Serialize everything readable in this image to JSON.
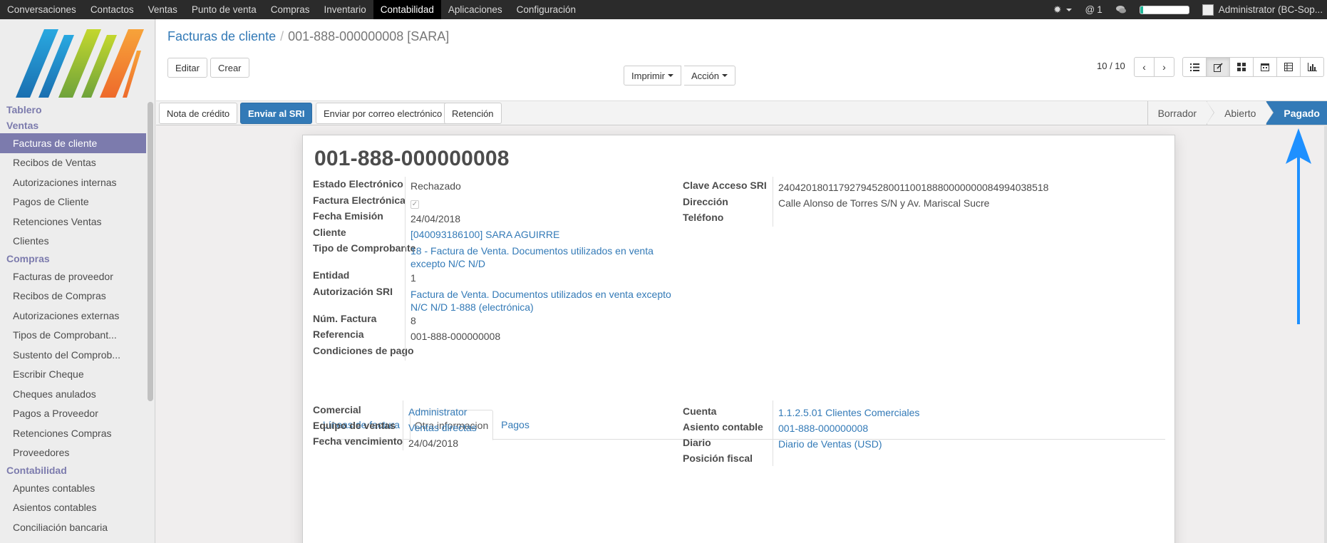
{
  "topbar": {
    "menu": [
      "Conversaciones",
      "Contactos",
      "Ventas",
      "Punto de venta",
      "Compras",
      "Inventario",
      "Contabilidad",
      "Aplicaciones",
      "Configuración"
    ],
    "active_menu": "Contabilidad",
    "mention_count": "1",
    "mention_symbol": "@",
    "user": "Administrator (BC-Sop...",
    "progress_fraction": 0.06,
    "progress_color": "#21b799"
  },
  "sidebar": {
    "sections": [
      {
        "head": "Tablero",
        "items": []
      },
      {
        "head": "Ventas",
        "items": [
          "Facturas de cliente",
          "Recibos de Ventas",
          "Autorizaciones internas",
          "Pagos de Cliente",
          "Retenciones Ventas",
          "Clientes"
        ]
      },
      {
        "head": "Compras",
        "items": [
          "Facturas de proveedor",
          "Recibos de Compras",
          "Autorizaciones externas",
          "Tipos de Comprobant...",
          "Sustento del Comprob...",
          "Escribir Cheque",
          "Cheques anulados",
          "Pagos a Proveedor",
          "Retenciones Compras",
          "Proveedores"
        ]
      },
      {
        "head": "Contabilidad",
        "items": [
          "Apuntes contables",
          "Asientos contables",
          "Conciliación bancaria"
        ]
      }
    ],
    "active_item": "Facturas de cliente",
    "accent_color": "#7c7bad"
  },
  "control_panel": {
    "breadcrumb_parent": "Facturas de cliente",
    "breadcrumb_sep": "/",
    "breadcrumb_current": "001-888-000000008 [SARA]",
    "edit_label": "Editar",
    "create_label": "Crear",
    "print_label": "Imprimir",
    "action_label": "Acción",
    "pager": "10 / 10"
  },
  "statusbar": {
    "buttons": [
      "Nota de crédito",
      "Enviar al SRI",
      "Enviar por correo electrónico",
      "Retención"
    ],
    "stages": [
      "Borrador",
      "Abierto",
      "Pagado"
    ],
    "current_stage": "Pagado",
    "primary_color": "#337ab7"
  },
  "form": {
    "title": "001-888-000000008",
    "left_fields": [
      {
        "label": "Estado Electrónico",
        "value": "Rechazado",
        "link": false
      },
      {
        "label": "Factura Electrónica",
        "value": "",
        "checkbox": true
      },
      {
        "label": "Fecha Emisión",
        "value": "24/04/2018",
        "link": false
      },
      {
        "label": "Cliente",
        "value": "[040093186100] SARA AGUIRRE",
        "link": true
      },
      {
        "label": "Tipo de Comprobante",
        "value": "18 - Factura de Venta. Documentos utilizados en venta excepto N/C N/D",
        "link": true
      },
      {
        "label": "Entidad",
        "value": "1",
        "link": false
      },
      {
        "label": "Autorización SRI",
        "value": "Factura de Venta. Documentos utilizados en venta excepto N/C N/D 1-888 (electrónica)",
        "link": true
      },
      {
        "label": "Núm. Factura",
        "value": "8",
        "link": false
      },
      {
        "label": "Referencia",
        "value": "001-888-000000008",
        "link": false
      },
      {
        "label": "Condiciones de pago",
        "value": "",
        "link": false
      }
    ],
    "right_fields": [
      {
        "label": "Clave Acceso SRI",
        "value": "2404201801179279452800110018880000000084994038518",
        "link": false
      },
      {
        "label": "Dirección",
        "value": "Calle Alonso de Torres S/N y Av. Mariscal Sucre",
        "link": false
      },
      {
        "label": "Teléfono",
        "value": "",
        "link": false
      }
    ],
    "tabs": [
      "Líneas de factura",
      "Otra informacion",
      "Pagos"
    ],
    "active_tab": "Otra informacion",
    "other_left": [
      {
        "label": "Comercial",
        "value": "Administrator",
        "link": true
      },
      {
        "label": "Equipo de ventas",
        "value": "Ventas directas",
        "link": true
      },
      {
        "label": "Fecha vencimiento",
        "value": "24/04/2018",
        "link": false
      }
    ],
    "other_right": [
      {
        "label": "Cuenta",
        "value": "1.1.2.5.01 Clientes Comerciales",
        "link": true
      },
      {
        "label": "Asiento contable",
        "value": "001-888-000000008",
        "link": true
      },
      {
        "label": "Diario",
        "value": "Diario de Ventas (USD)",
        "link": true
      },
      {
        "label": "Posición fiscal",
        "value": "",
        "link": false
      }
    ]
  },
  "annotation": {
    "color": "#1e90ff"
  }
}
